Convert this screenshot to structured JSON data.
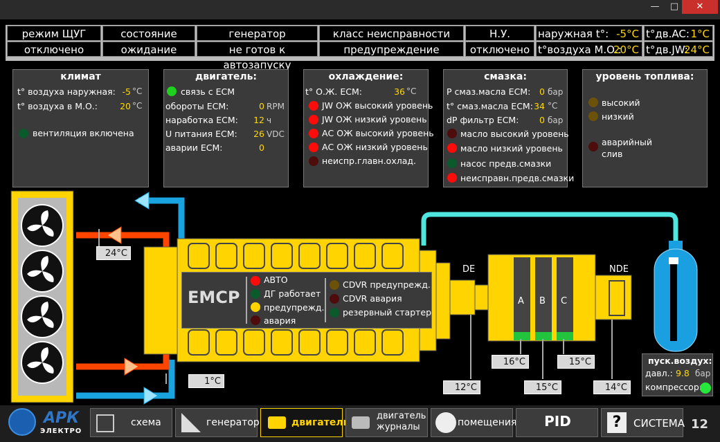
{
  "header": {
    "mode_label": "режим ЩУГ",
    "mode_value": "отключено",
    "state_label": "состояние",
    "state_value": "ожидание",
    "gen_label": "генератор",
    "gen_value": "не готов к автозапуску",
    "fault_label": "класс неисправности",
    "fault_value": "предупреждение",
    "nu_label": "Н.У.",
    "nu_value": "отключено",
    "outside_temp_label": "наружная t°:",
    "outside_temp_value": "-5°C",
    "mo_temp_label": "t°воздуха М.О.:",
    "mo_temp_value": "20°C",
    "ac_temp_label": "t°дв.AC:",
    "ac_temp_value": "1°C",
    "jw_temp_label": "t°дв.JW:",
    "jw_temp_value": "24°C"
  },
  "climate": {
    "title": "климат",
    "outside_label": "t° воздуха наружная:",
    "outside_value": "-5",
    "outside_unit": "°C",
    "mo_label": "t° воздуха в М.О.:",
    "mo_value": "20",
    "mo_unit": "°C",
    "vent_label": "вентиляция включена"
  },
  "engine": {
    "title": "двигатель:",
    "ecm_link": "связь с ECM",
    "rpm_label": "обороты ECM:",
    "rpm_value": "0",
    "rpm_unit": "RPM",
    "hours_label": "наработка ECM:",
    "hours_value": "12",
    "hours_unit": "ч",
    "volt_label": "U питания ECM:",
    "volt_value": "26",
    "volt_unit": "VDC",
    "alarms_label": "аварии ECM:",
    "alarms_value": "0"
  },
  "cooling": {
    "title": "охлаждение:",
    "temp_label": "t° О.Ж. ECM:",
    "temp_value": "36",
    "temp_unit": "°C",
    "items": [
      "JW ОЖ высокий уровень",
      "JW ОЖ низкий уровень",
      "АС ОЖ высокий уровень",
      "АС ОЖ низкий уровень",
      "неиспр.главн.охлад."
    ]
  },
  "lube": {
    "title": "смазка:",
    "pressure_label": "Р смаз.масла ECM:",
    "pressure_value": "0",
    "pressure_unit": "бар",
    "temp_label": "t° смаз.масла ECM:",
    "temp_value": "34",
    "temp_unit": "°C",
    "dp_label": "dP фильтр ECM:",
    "dp_value": "0",
    "dp_unit": "бар",
    "items": [
      "масло высокий уровень",
      "масло низкий уровень",
      "насос предв.смазки",
      "неисправн.предв.смазки"
    ]
  },
  "fuel": {
    "title": "уровень топлива:",
    "high": "высокий",
    "low": "низкий",
    "emergency": "аварийный слив"
  },
  "diagram": {
    "radiator_hot_temp": "24°C",
    "radiator_cold_temp": "1°C",
    "emcp_title": "EMCP",
    "emcp_auto": "АВТО",
    "emcp_running": "ДГ работает",
    "emcp_warning": "предупрежд.",
    "emcp_alarm": "авария",
    "cdvr_warning": "CDVR предупрежд.",
    "cdvr_alarm": "CDVR авария",
    "backup_starter": "резервный стартер",
    "de_label": "DE",
    "nde_label": "NDE",
    "phase_a": "A",
    "phase_b": "B",
    "phase_c": "C",
    "t_de": "12°C",
    "t_a": "16°C",
    "t_b": "15°C",
    "t_c": "15°C",
    "t_nde": "14°C",
    "air_title": "пуск.воздух:",
    "air_pressure_label": "давл.:",
    "air_pressure_value": "9.8",
    "air_pressure_unit": "бар",
    "compressor_label": "компрессор:"
  },
  "nav": {
    "logo": "АРК",
    "logo_sub": "ЭЛЕКТРО",
    "scheme": "схема",
    "generator": "генератор",
    "engine": "двигатель",
    "engine_log_1": "двигатель",
    "engine_log_2": "журналы",
    "rooms": "помещения",
    "pid": "PID",
    "system": "СИСТЕМА",
    "page": "12"
  },
  "colors": {
    "accent_yellow": "#ffd800",
    "hot_pipe": "#ff4500",
    "cold_pipe": "#19a3df",
    "engine_yellow": "#ffd400"
  }
}
